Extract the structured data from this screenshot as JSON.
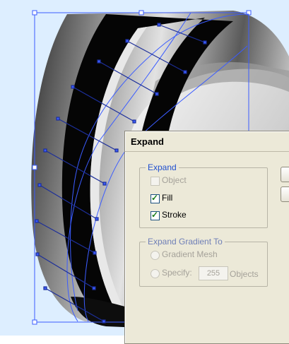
{
  "dialog": {
    "title": "Expand",
    "expand_group": {
      "legend": "Expand",
      "object_label": "Object",
      "fill_label": "Fill",
      "stroke_label": "Stroke"
    },
    "gradient_group": {
      "legend": "Expand Gradient To",
      "mesh_label": "Gradient Mesh",
      "specify_label": "Specify:",
      "specify_value": "255",
      "objects_label": "Objects"
    }
  },
  "artwork": {
    "background_color": "#ddeeff",
    "selection_color": "#3b5cff",
    "ring_colors": [
      "#1a1a1a",
      "#d0d0d0",
      "#6b6b6b"
    ]
  }
}
